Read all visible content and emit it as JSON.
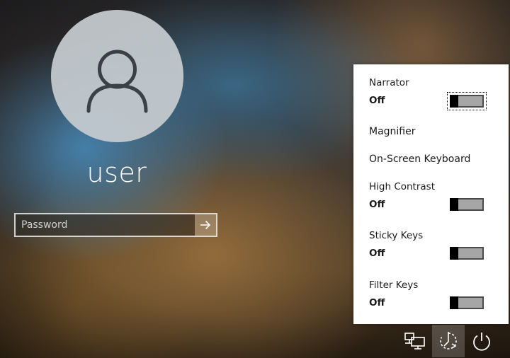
{
  "user": {
    "name": "user"
  },
  "password": {
    "placeholder": "Password",
    "value": ""
  },
  "ease_of_access": {
    "narrator": {
      "label": "Narrator",
      "state": "Off"
    },
    "magnifier": {
      "label": "Magnifier"
    },
    "on_screen_keyboard": {
      "label": "On-Screen Keyboard"
    },
    "high_contrast": {
      "label": "High Contrast",
      "state": "Off"
    },
    "sticky_keys": {
      "label": "Sticky Keys",
      "state": "Off"
    },
    "filter_keys": {
      "label": "Filter Keys",
      "state": "Off"
    }
  },
  "tray": {
    "network_icon": "network-icon",
    "ease_of_access_icon": "ease-of-access-icon",
    "power_icon": "power-icon"
  },
  "colors": {
    "flyout_bg": "#ffffff",
    "toggle_track": "#a6a6a6",
    "toggle_knob": "#000000"
  }
}
